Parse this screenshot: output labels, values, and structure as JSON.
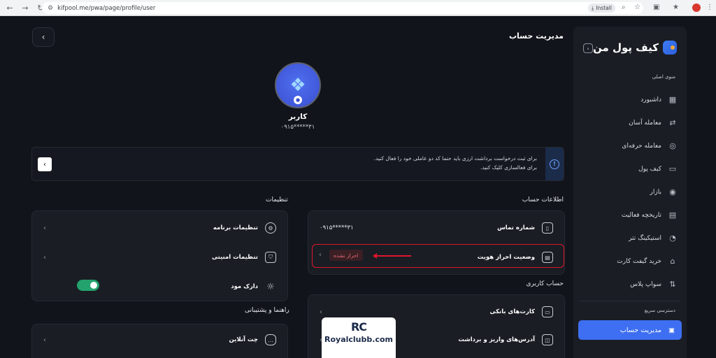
{
  "browser": {
    "url": "kifpool.me/pwa/page/profile/user",
    "install_label": "Install"
  },
  "sidebar": {
    "brand": "کیف پول من",
    "menu_title": "منوی اصلی",
    "items": [
      {
        "label": "داشبورد",
        "icon": "grid-icon"
      },
      {
        "label": "معامله آسان",
        "icon": "exchange-icon"
      },
      {
        "label": "معامله حرفه‌ای",
        "icon": "pro-trade-icon"
      },
      {
        "label": "کیف پول",
        "icon": "wallet-icon"
      },
      {
        "label": "بازار",
        "icon": "market-icon"
      },
      {
        "label": "تاریخچه فعالیت",
        "icon": "history-icon"
      },
      {
        "label": "استیکینگ تتر",
        "icon": "staking-icon"
      },
      {
        "label": "خرید گیفت کارت",
        "icon": "gift-icon"
      },
      {
        "label": "سواپ پلاس",
        "icon": "swap-icon"
      }
    ],
    "quick_access_title": "دسترسی سریع",
    "account_button": "مدیریت حساب"
  },
  "header": {
    "title": "مدیریت حساب"
  },
  "profile": {
    "name": "کاربر",
    "phone": "۰۹۱۵*****۳۱"
  },
  "alert": {
    "line1": "برای ثبت درخواست برداشت ارزی باید حتما کد دو عاملی خود را فعال کنید.",
    "line2": "برای فعالسازی کلیک کنید."
  },
  "account_info": {
    "title": "اطلاعات حساب",
    "phone_label": "شماره تماس",
    "phone_value": "۰۹۱۵*****۳۱",
    "kyc_label": "وضعیت احراز هویت",
    "kyc_status": "احراز نشده"
  },
  "user_account": {
    "title": "حساب کاربری",
    "bank_cards": "کارت‌های بانکی",
    "addresses": "آدرس‌های واریز و برداشت"
  },
  "settings": {
    "title": "تنظیمات",
    "app_settings": "تنظیمات برنامه",
    "security_settings": "تنظیمات امنیتی",
    "dark_mode": "دارک مود",
    "dark_mode_on": true
  },
  "support": {
    "title": "راهنما و پشتیبانی",
    "online_chat": "چت آنلاین"
  },
  "watermark": {
    "logo": "RC",
    "text": "Royalclubb.com"
  }
}
